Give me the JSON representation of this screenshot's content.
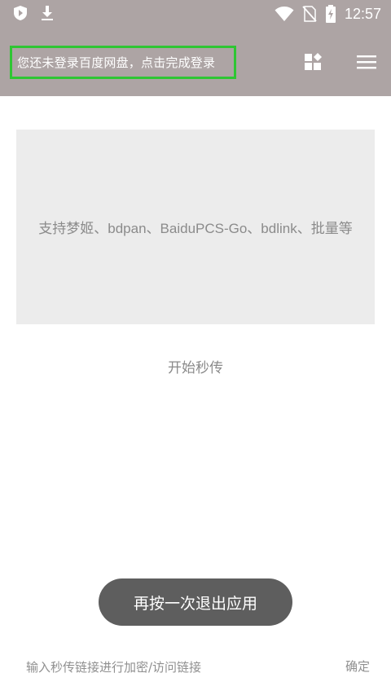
{
  "status_bar": {
    "time": "12:57",
    "icons": [
      "shield-icon",
      "download-icon",
      "wifi-icon",
      "no-sim-icon",
      "battery-charging-icon"
    ]
  },
  "app_bar": {
    "login_prompt": "您还未登录百度网盘，点击完成登录",
    "icons": [
      "widgets-icon",
      "menu-icon"
    ]
  },
  "info_card": {
    "text": "支持梦姬、bdpan、BaiduPCS-Go、bdlink、批量等"
  },
  "start_button": {
    "label": "开始秒传"
  },
  "toast": {
    "text": "再按一次退出应用"
  },
  "bottom_bar": {
    "input_placeholder": "输入秒传链接进行加密/访问链接",
    "confirm_label": "确定"
  },
  "colors": {
    "app_bar": "#ada4a4",
    "highlight_border": "#2ec633",
    "card_bg": "#ececec",
    "toast_bg": "#5e5e5e"
  }
}
